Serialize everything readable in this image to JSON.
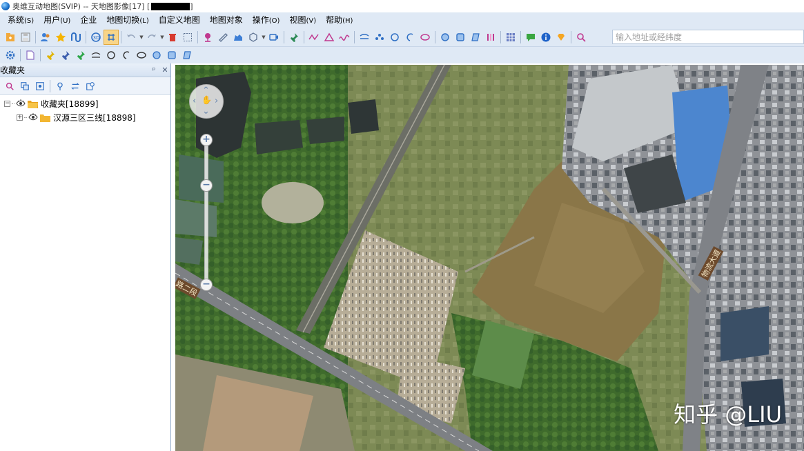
{
  "window": {
    "title": "奥维互动地图(SVIP) -- 天地图影像[17] ["
  },
  "menu": [
    {
      "label": "系统",
      "acc": "(S)"
    },
    {
      "label": "用户",
      "acc": "(U)"
    },
    {
      "label": "企业",
      "acc": ""
    },
    {
      "label": "地图切换",
      "acc": "(L)"
    },
    {
      "label": "自定义地图",
      "acc": ""
    },
    {
      "label": "地图对象",
      "acc": ""
    },
    {
      "label": "操作",
      "acc": "(O)"
    },
    {
      "label": "视图",
      "acc": "(V)"
    },
    {
      "label": "帮助",
      "acc": "(H)"
    }
  ],
  "search": {
    "placeholder": "输入地址或经纬度"
  },
  "panel": {
    "title": "收藏夹",
    "pin": "ᵖ",
    "close": "✕"
  },
  "tree": {
    "root": {
      "label": "收藏夹[18899]",
      "expander": "−"
    },
    "child": {
      "label": "汉源三区三线[18898]",
      "expander": "+"
    }
  },
  "map": {
    "road_label_1": "路二段",
    "road_label_2": "物流大道",
    "watermark": "知乎 @LIU",
    "zoom_in": "+",
    "zoom_mid": "−",
    "zoom_out": "−"
  },
  "colors": {
    "chrome": "#dfe9f5",
    "active_tool": "#f8d589",
    "folder": "#f2b632"
  },
  "icons": {
    "toolbar1": [
      "new-icon",
      "save-icon",
      "users-icon",
      "star-icon",
      "route-icon",
      "3d-icon",
      "select-toggle-icon",
      "undo-icon",
      "redo-icon",
      "delete-icon",
      "box-select-icon",
      "pin-icon",
      "ruler-icon",
      "elevation-icon",
      "polygon-icon",
      "video-icon",
      "push-pin-icon",
      "line-icon",
      "triangle-icon",
      "curve-icon",
      "path-icon",
      "dots-icon",
      "circle-icon",
      "arc-icon",
      "ellipse-icon",
      "disc-icon",
      "square-icon",
      "shape-icon",
      "bars-icon",
      "grid-icon",
      "chat-icon",
      "info-icon",
      "diamond-icon",
      "search-icon"
    ],
    "toolbar2": [
      "settings-icon",
      "document-icon",
      "yellow-pin-icon",
      "blue-pin-icon",
      "green-pin-icon",
      "arc-line-icon",
      "circle-icon",
      "arc-icon",
      "ellipse-icon",
      "disc-icon",
      "square-icon",
      "shape-icon"
    ],
    "panel_tools": [
      "search-icon",
      "copy-icon",
      "locate-icon",
      "pin-icon",
      "swap-icon",
      "export-icon"
    ]
  }
}
